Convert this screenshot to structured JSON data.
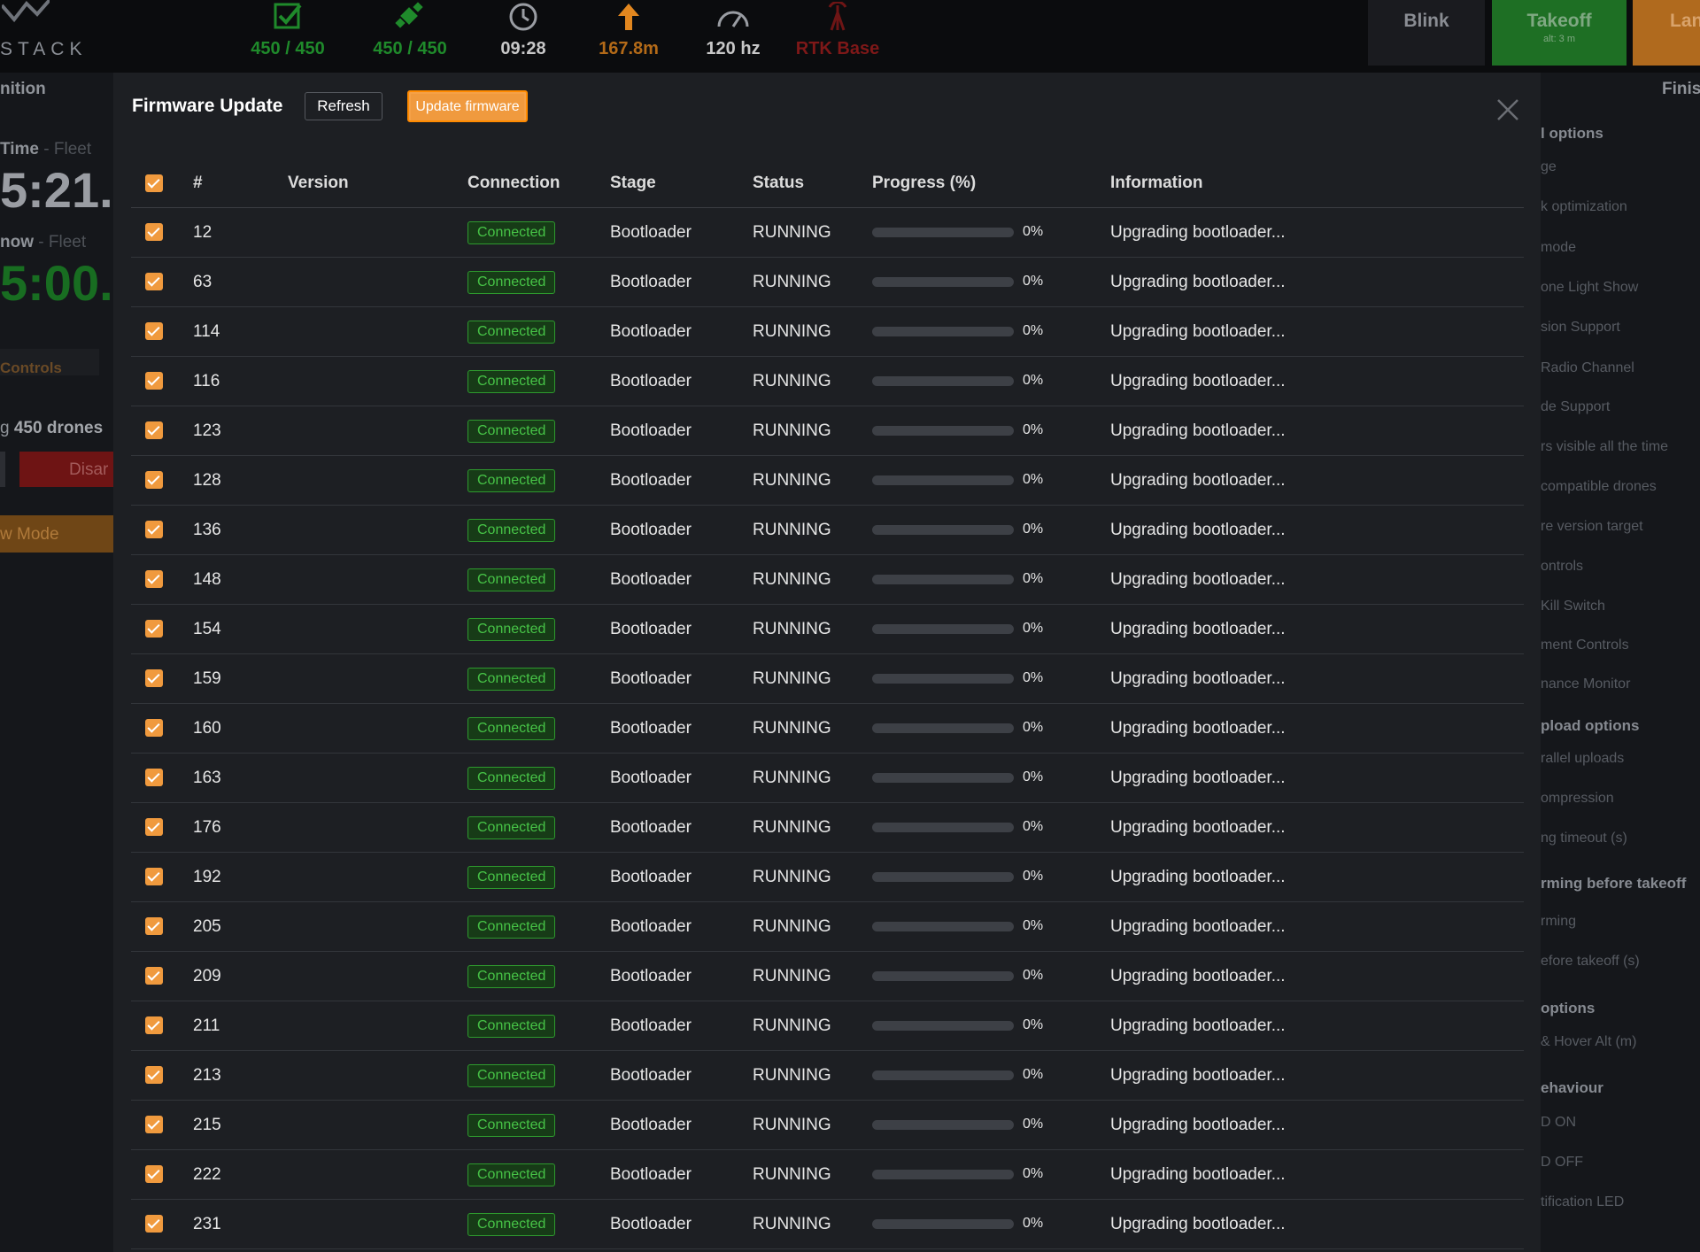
{
  "topbar": {
    "logo": "STACK",
    "stats": [
      {
        "icon": "check-icon",
        "value": "450 / 450",
        "color": "#1f8a2b"
      },
      {
        "icon": "satellite-icon",
        "value": "450 / 450",
        "color": "#1f8a2b"
      },
      {
        "icon": "clock-icon",
        "value": "09:28",
        "color": "#c8c8c8"
      },
      {
        "icon": "altitude-arrow-icon",
        "value": "167.8m",
        "color": "#e2871f"
      },
      {
        "icon": "gauge-icon",
        "value": "120 hz",
        "color": "#c8c8c8"
      },
      {
        "icon": "rtk-tower-icon",
        "value": "RTK Base",
        "color": "#8e1a1a"
      }
    ],
    "blink_label": "Blink",
    "takeoff_label": "Takeoff",
    "takeoff_sub": "alt: 3 m",
    "land_label": "Lan"
  },
  "background_left": {
    "section": "nition",
    "time_label": "Time",
    "time_suffix": "- Fleet",
    "time_value": "5:21.",
    "now_label": "now",
    "now_suffix": "- Fleet",
    "now_value": "5:00.",
    "controls": "Controls",
    "drones_prefix": "g ",
    "drones_count": "450 drones",
    "disarm": "Disar",
    "mode": "w Mode"
  },
  "background_right": {
    "finish": "Finis",
    "items": [
      {
        "text": "l options",
        "h": true
      },
      {
        "text": "ge",
        "h": false
      },
      {
        "text": "k optimization",
        "h": false
      },
      {
        "text": "mode",
        "h": false
      },
      {
        "text": "one Light Show",
        "h": false
      },
      {
        "text": "sion Support",
        "h": false
      },
      {
        "text": "Radio Channel",
        "h": false
      },
      {
        "text": "de Support",
        "h": false
      },
      {
        "text": "rs visible all the time",
        "h": false
      },
      {
        "text": "compatible drones",
        "h": false
      },
      {
        "text": "re version target",
        "h": false
      },
      {
        "text": "ontrols",
        "h": false
      },
      {
        "text": "Kill Switch",
        "h": false
      },
      {
        "text": "ment Controls",
        "h": false
      },
      {
        "text": "nance Monitor",
        "h": false
      },
      {
        "text": "pload options",
        "h": true
      },
      {
        "text": "rallel uploads",
        "h": false
      },
      {
        "text": "ompression",
        "h": false
      },
      {
        "text": "ng timeout (s)",
        "h": false
      },
      {
        "text": "rming before takeoff",
        "h": true
      },
      {
        "text": "rming",
        "h": false
      },
      {
        "text": "efore takeoff (s)",
        "h": false
      },
      {
        "text": "options",
        "h": true
      },
      {
        "text": "& Hover Alt (m)",
        "h": false
      },
      {
        "text": "ehaviour",
        "h": true
      },
      {
        "text": "D ON",
        "h": false
      },
      {
        "text": "D OFF",
        "h": false
      },
      {
        "text": "tification LED",
        "h": false
      }
    ]
  },
  "modal": {
    "title": "Firmware Update",
    "refresh_label": "Refresh",
    "update_label": "Update firmware",
    "columns": [
      "#",
      "Version",
      "Connection",
      "Stage",
      "Status",
      "Progress (%)",
      "Information"
    ],
    "rows": [
      {
        "id": "12",
        "version": "",
        "connection": "Connected",
        "stage": "Bootloader",
        "status": "RUNNING",
        "progress": 0,
        "progress_label": "0%",
        "info": "Upgrading bootloader..."
      },
      {
        "id": "63",
        "version": "",
        "connection": "Connected",
        "stage": "Bootloader",
        "status": "RUNNING",
        "progress": 0,
        "progress_label": "0%",
        "info": "Upgrading bootloader..."
      },
      {
        "id": "114",
        "version": "",
        "connection": "Connected",
        "stage": "Bootloader",
        "status": "RUNNING",
        "progress": 0,
        "progress_label": "0%",
        "info": "Upgrading bootloader..."
      },
      {
        "id": "116",
        "version": "",
        "connection": "Connected",
        "stage": "Bootloader",
        "status": "RUNNING",
        "progress": 0,
        "progress_label": "0%",
        "info": "Upgrading bootloader..."
      },
      {
        "id": "123",
        "version": "",
        "connection": "Connected",
        "stage": "Bootloader",
        "status": "RUNNING",
        "progress": 0,
        "progress_label": "0%",
        "info": "Upgrading bootloader..."
      },
      {
        "id": "128",
        "version": "",
        "connection": "Connected",
        "stage": "Bootloader",
        "status": "RUNNING",
        "progress": 0,
        "progress_label": "0%",
        "info": "Upgrading bootloader..."
      },
      {
        "id": "136",
        "version": "",
        "connection": "Connected",
        "stage": "Bootloader",
        "status": "RUNNING",
        "progress": 0,
        "progress_label": "0%",
        "info": "Upgrading bootloader..."
      },
      {
        "id": "148",
        "version": "",
        "connection": "Connected",
        "stage": "Bootloader",
        "status": "RUNNING",
        "progress": 0,
        "progress_label": "0%",
        "info": "Upgrading bootloader..."
      },
      {
        "id": "154",
        "version": "",
        "connection": "Connected",
        "stage": "Bootloader",
        "status": "RUNNING",
        "progress": 0,
        "progress_label": "0%",
        "info": "Upgrading bootloader..."
      },
      {
        "id": "159",
        "version": "",
        "connection": "Connected",
        "stage": "Bootloader",
        "status": "RUNNING",
        "progress": 0,
        "progress_label": "0%",
        "info": "Upgrading bootloader..."
      },
      {
        "id": "160",
        "version": "",
        "connection": "Connected",
        "stage": "Bootloader",
        "status": "RUNNING",
        "progress": 0,
        "progress_label": "0%",
        "info": "Upgrading bootloader..."
      },
      {
        "id": "163",
        "version": "",
        "connection": "Connected",
        "stage": "Bootloader",
        "status": "RUNNING",
        "progress": 0,
        "progress_label": "0%",
        "info": "Upgrading bootloader..."
      },
      {
        "id": "176",
        "version": "",
        "connection": "Connected",
        "stage": "Bootloader",
        "status": "RUNNING",
        "progress": 0,
        "progress_label": "0%",
        "info": "Upgrading bootloader..."
      },
      {
        "id": "192",
        "version": "",
        "connection": "Connected",
        "stage": "Bootloader",
        "status": "RUNNING",
        "progress": 0,
        "progress_label": "0%",
        "info": "Upgrading bootloader..."
      },
      {
        "id": "205",
        "version": "",
        "connection": "Connected",
        "stage": "Bootloader",
        "status": "RUNNING",
        "progress": 0,
        "progress_label": "0%",
        "info": "Upgrading bootloader..."
      },
      {
        "id": "209",
        "version": "",
        "connection": "Connected",
        "stage": "Bootloader",
        "status": "RUNNING",
        "progress": 0,
        "progress_label": "0%",
        "info": "Upgrading bootloader..."
      },
      {
        "id": "211",
        "version": "",
        "connection": "Connected",
        "stage": "Bootloader",
        "status": "RUNNING",
        "progress": 0,
        "progress_label": "0%",
        "info": "Upgrading bootloader..."
      },
      {
        "id": "213",
        "version": "",
        "connection": "Connected",
        "stage": "Bootloader",
        "status": "RUNNING",
        "progress": 0,
        "progress_label": "0%",
        "info": "Upgrading bootloader..."
      },
      {
        "id": "215",
        "version": "",
        "connection": "Connected",
        "stage": "Bootloader",
        "status": "RUNNING",
        "progress": 0,
        "progress_label": "0%",
        "info": "Upgrading bootloader..."
      },
      {
        "id": "222",
        "version": "",
        "connection": "Connected",
        "stage": "Bootloader",
        "status": "RUNNING",
        "progress": 0,
        "progress_label": "0%",
        "info": "Upgrading bootloader..."
      },
      {
        "id": "231",
        "version": "",
        "connection": "Connected",
        "stage": "Bootloader",
        "status": "RUNNING",
        "progress": 0,
        "progress_label": "0%",
        "info": "Upgrading bootloader..."
      }
    ]
  },
  "colors": {
    "accent_orange": "#f09a3e",
    "connected_green": "#47c447",
    "takeoff_green": "#1e6f24",
    "alert_red": "#a31c1c"
  }
}
